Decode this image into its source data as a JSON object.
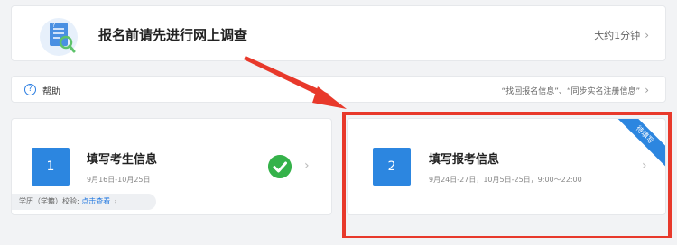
{
  "survey": {
    "title": "报名前请先进行网上调查",
    "time_label": "大约1分钟"
  },
  "help": {
    "label": "帮助",
    "links": "“找回报名信息”、“同步实名注册信息”"
  },
  "steps": [
    {
      "number": "1",
      "title": "填写考生信息",
      "date": "9月16日-10月25日",
      "status": "completed",
      "edu_label": "学历（学籍）校验:",
      "edu_link": "点击查看"
    },
    {
      "number": "2",
      "title": "填写报考信息",
      "date": "9月24日-27日，10月5日-25日，9:00～22:00",
      "badge": "待填写"
    }
  ],
  "colors": {
    "accent": "#2c86e0",
    "success": "#35b24a",
    "highlight": "#e8392b"
  },
  "icons": {
    "survey": "survey-document-magnifier-icon",
    "help": "question-circle-icon",
    "check": "check-circle-icon",
    "chevron": "chevron-right-icon",
    "arrow": "red-arrow-annotation"
  }
}
